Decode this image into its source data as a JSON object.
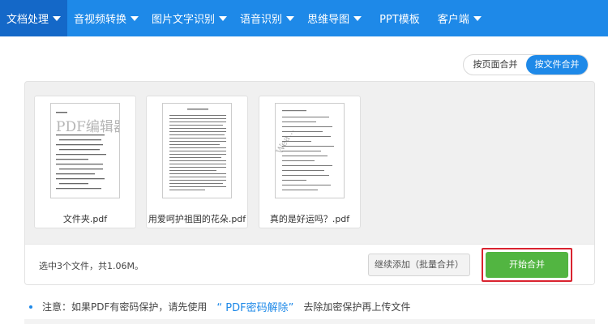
{
  "nav": {
    "items": [
      {
        "label": "文档处理",
        "caret": true,
        "active": true
      },
      {
        "label": "音视频转换",
        "caret": true
      },
      {
        "label": "图片文字识别",
        "caret": true
      },
      {
        "label": "语音识别",
        "caret": true
      },
      {
        "label": "思维导图",
        "caret": true
      },
      {
        "label": "PPT模板",
        "caret": false
      },
      {
        "label": "客户端",
        "caret": true
      }
    ]
  },
  "merge_mode": {
    "by_page": "按页面合并",
    "by_file": "按文件合并",
    "selected": "按文件合并"
  },
  "files": [
    {
      "name": "文件夹.pdf",
      "watermark": "PDF编辑器"
    },
    {
      "name": "用爱呵护祖国的花朵.pdf"
    },
    {
      "name": "真的是好运吗？.pdf",
      "watermark": "Wea..."
    }
  ],
  "summary": "选中3个文件，共1.06M。",
  "buttons": {
    "continue_add": "继续添加（批量合并）",
    "start_merge": "开始合并"
  },
  "note": {
    "prefix": "注意：如果PDF有密码保护，请先使用",
    "link": "“ PDF密码解除”",
    "suffix": "去除加密保护再上传文件"
  },
  "colors": {
    "nav_bg": "#1e89e8",
    "nav_active": "#1468c8",
    "start_button": "#52b541",
    "highlight_frame": "#d9232f",
    "link": "#1e89e8"
  }
}
